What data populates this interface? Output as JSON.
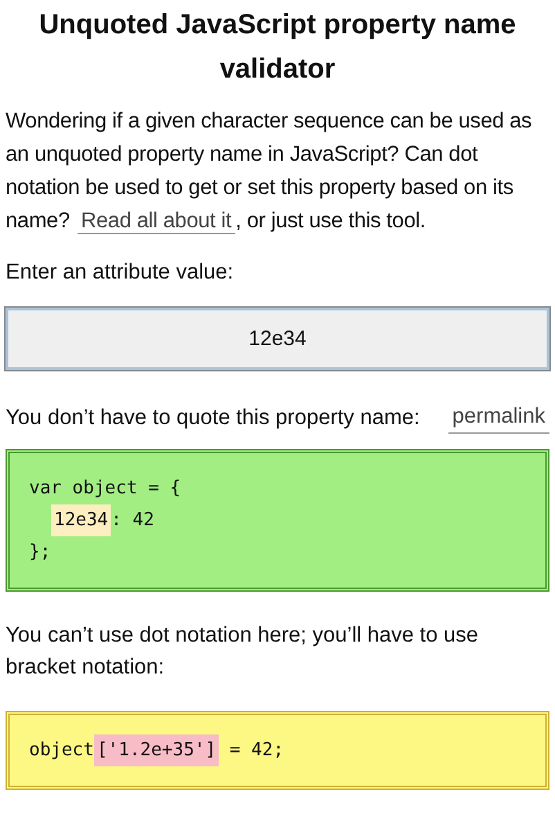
{
  "title": "Unquoted JavaScript property name validator",
  "intro": {
    "before": "Wondering if a given character sequence can be used as an unquoted property name in JavaScript? Can dot notation be used to get or set this property based on its name?",
    "link": "Read all about it",
    "after": ", or just use this tool."
  },
  "input_label": "Enter an attribute value:",
  "input": {
    "value": "12e34"
  },
  "results": [
    {
      "kind": "valid",
      "message": "You don’t have to quote this property name:",
      "link": "permalink",
      "code_lines": [
        {
          "indented": false,
          "segments": [
            {
              "text": "var object = {",
              "highlighted": false
            }
          ]
        },
        {
          "indented": true,
          "segments": [
            {
              "text": "12e34",
              "highlighted": true
            },
            {
              "text": ": 42",
              "highlighted": false
            }
          ]
        },
        {
          "indented": false,
          "segments": [
            {
              "text": "};",
              "highlighted": false
            }
          ]
        }
      ]
    },
    {
      "kind": "invalid",
      "message": "You can’t use dot notation here; you’ll have to use bracket notation:",
      "code_lines": [
        {
          "indented": false,
          "segments": [
            {
              "text": "object",
              "highlighted": false
            },
            {
              "text": "['1.2e+35']",
              "highlighted": true
            },
            {
              "text": " = 42;",
              "highlighted": false
            }
          ]
        }
      ]
    }
  ]
}
